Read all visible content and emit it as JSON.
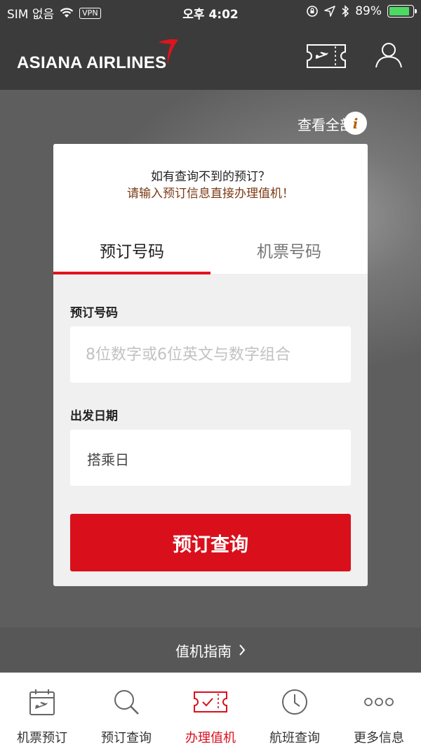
{
  "status_bar": {
    "carrier": "SIM 없음",
    "vpn": "VPN",
    "time": "오후 4:02",
    "battery": "89%",
    "battery_level": 0.89
  },
  "header": {
    "brand": "ASIANA AIRLINES"
  },
  "view_all": "查看全部",
  "card": {
    "notice_line1": "如有查询不到的预订？",
    "notice_line2": "请输入预订信息直接办理值机！",
    "tabs": [
      {
        "label": "预订号码"
      },
      {
        "label": "机票号码"
      }
    ],
    "booking_label": "预订号码",
    "booking_placeholder": "8位数字或6位英文与数字组合",
    "date_label": "出发日期",
    "date_value": "搭乘日",
    "submit": "预订查询"
  },
  "guide": "值机指南",
  "tab_bar": [
    {
      "label": "机票预订",
      "icon": "calendar-plane-icon"
    },
    {
      "label": "预订查询",
      "icon": "search-icon"
    },
    {
      "label": "办理值机",
      "icon": "ticket-check-icon"
    },
    {
      "label": "航班查询",
      "icon": "clock-icon"
    },
    {
      "label": "更多信息",
      "icon": "more-dots-icon"
    }
  ],
  "colors": {
    "accent_red": "#d9101c",
    "header_dark": "#3b3b3b",
    "notice_brown": "#7a3a14"
  }
}
